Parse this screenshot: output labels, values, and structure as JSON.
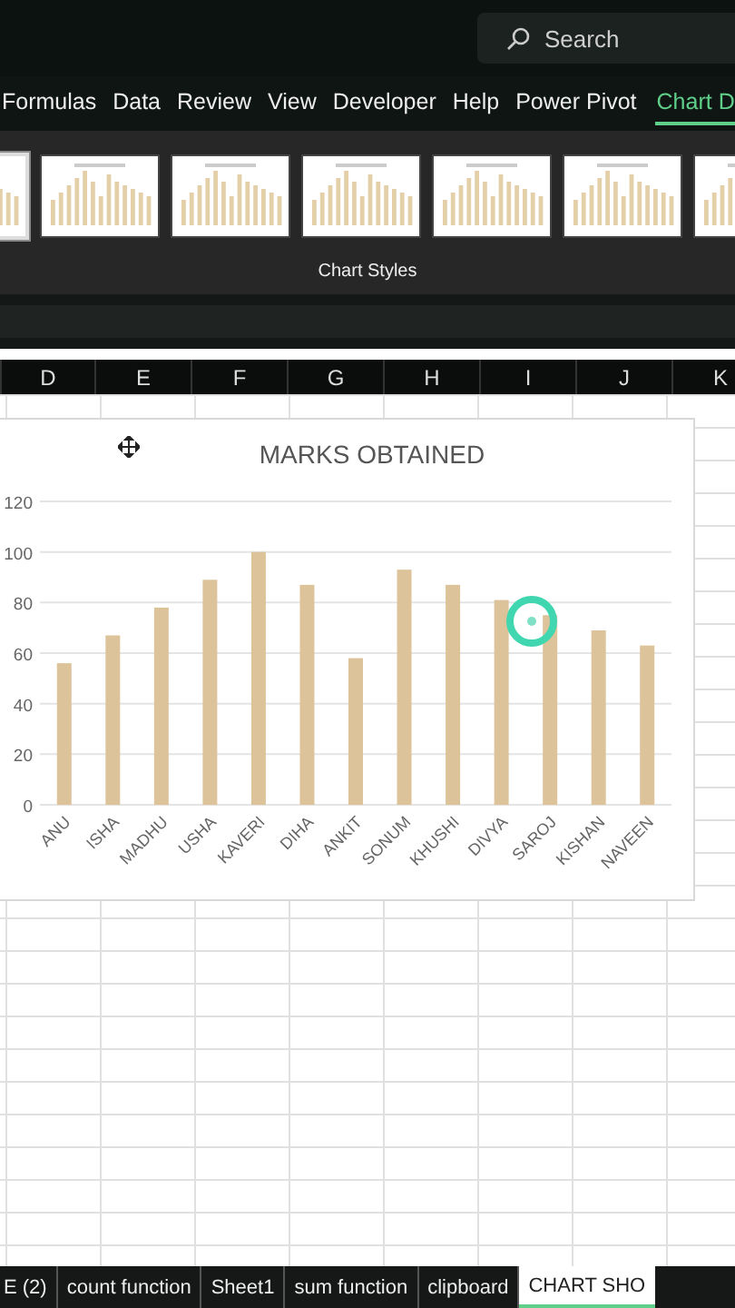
{
  "search": {
    "placeholder": "Search"
  },
  "ribbon_tabs": [
    {
      "label": "Formulas",
      "selected": false
    },
    {
      "label": "Data",
      "selected": false
    },
    {
      "label": "Review",
      "selected": false
    },
    {
      "label": "View",
      "selected": false
    },
    {
      "label": "Developer",
      "selected": false
    },
    {
      "label": "Help",
      "selected": false
    },
    {
      "label": "Power Pivot",
      "selected": false
    },
    {
      "label": "Chart D",
      "selected": true
    }
  ],
  "chart_styles": {
    "label": "Chart Styles",
    "thumbnails": [
      {
        "selected": true
      },
      {
        "selected": false
      },
      {
        "selected": false
      },
      {
        "selected": false
      },
      {
        "selected": false
      },
      {
        "selected": false
      },
      {
        "selected": false
      }
    ]
  },
  "columns": [
    "D",
    "E",
    "F",
    "G",
    "H",
    "I",
    "J",
    "K"
  ],
  "chart": {
    "chart_data": {
      "type": "bar",
      "title": "MARKS OBTAINED",
      "categories": [
        "ANU",
        "ISHA",
        "MADHU",
        "USHA",
        "KAVERI",
        "DIHA",
        "ANKIT",
        "SONUM",
        "KHUSHI",
        "DIVYA",
        "SAROJ",
        "KISHAN",
        "NAVEEN"
      ],
      "values": [
        56,
        67,
        78,
        89,
        100,
        87,
        58,
        93,
        87,
        81,
        75,
        69,
        63
      ],
      "grid": true,
      "ylim": [
        0,
        120
      ],
      "yticks": [
        0,
        20,
        40,
        60,
        80,
        100,
        120
      ]
    }
  },
  "sheet_tabs": [
    {
      "label": "E (2)",
      "selected": false
    },
    {
      "label": "count function",
      "selected": false
    },
    {
      "label": "Sheet1",
      "selected": false
    },
    {
      "label": "sum function",
      "selected": false
    },
    {
      "label": "clipboard",
      "selected": false
    },
    {
      "label": "CHART SHO",
      "selected": true
    }
  ]
}
